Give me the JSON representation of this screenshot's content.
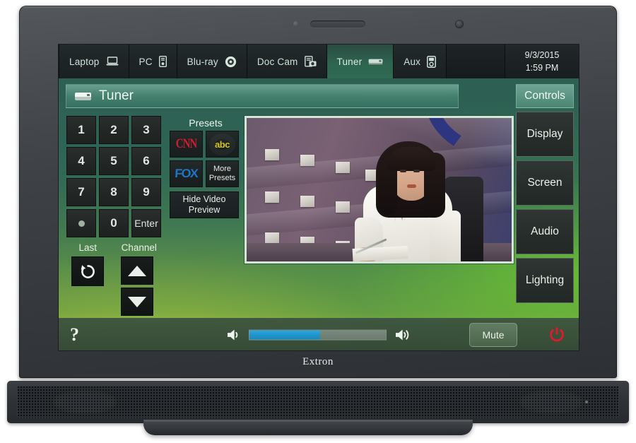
{
  "device": {
    "brand": "Extron"
  },
  "tabs": [
    {
      "label": "Laptop",
      "icon": "laptop-icon",
      "active": false
    },
    {
      "label": "PC",
      "icon": "desktop-tower-icon",
      "active": false
    },
    {
      "label": "Blu-ray",
      "icon": "disc-icon",
      "active": false
    },
    {
      "label": "Doc Cam",
      "icon": "doc-cam-icon",
      "active": false
    },
    {
      "label": "Tuner",
      "icon": "tuner-box-icon",
      "active": true
    },
    {
      "label": "Aux",
      "icon": "media-player-icon",
      "active": false
    }
  ],
  "clock": {
    "date": "9/3/2015",
    "time": "1:59 PM"
  },
  "title": {
    "text": "Tuner",
    "icon": "tuner-box-icon"
  },
  "controls_column": {
    "items": [
      {
        "label": "Controls",
        "selected": true
      },
      {
        "label": "Display",
        "selected": false
      },
      {
        "label": "Screen",
        "selected": false
      },
      {
        "label": "Audio",
        "selected": false
      },
      {
        "label": "Lighting",
        "selected": false
      }
    ]
  },
  "keypad": {
    "keys": [
      "1",
      "2",
      "3",
      "4",
      "5",
      "6",
      "7",
      "8",
      "9",
      "•",
      "0",
      "Enter"
    ]
  },
  "transport": {
    "last_label": "Last",
    "channel_label": "Channel",
    "last_icon": "refresh-circular-arrow-icon",
    "channel_up_icon": "triangle-up-icon",
    "channel_down_icon": "triangle-down-icon"
  },
  "presets": {
    "label": "Presets",
    "items": [
      {
        "name": "CNN",
        "text": "CNN",
        "color": "#cc1f2e"
      },
      {
        "name": "abc",
        "text": "abc",
        "color": "#d4c21f"
      },
      {
        "name": "FOX",
        "text": "FOX",
        "color": "#1e74c4"
      },
      {
        "name": "more",
        "text": "More Presets",
        "color": "#e3ebe3"
      }
    ]
  },
  "video_preview": {
    "hide_button_label": "Hide Video Preview",
    "description": "news-anchor-studio-video"
  },
  "bottom_bar": {
    "help_label": "?",
    "volume_down_icon": "speaker-low-icon",
    "volume_up_icon": "speaker-high-icon",
    "volume_percent": 52,
    "mute_label": "Mute",
    "power_icon": "power-icon",
    "power_color": "#e8172a",
    "slider_fill_color": "#1f93c9"
  }
}
